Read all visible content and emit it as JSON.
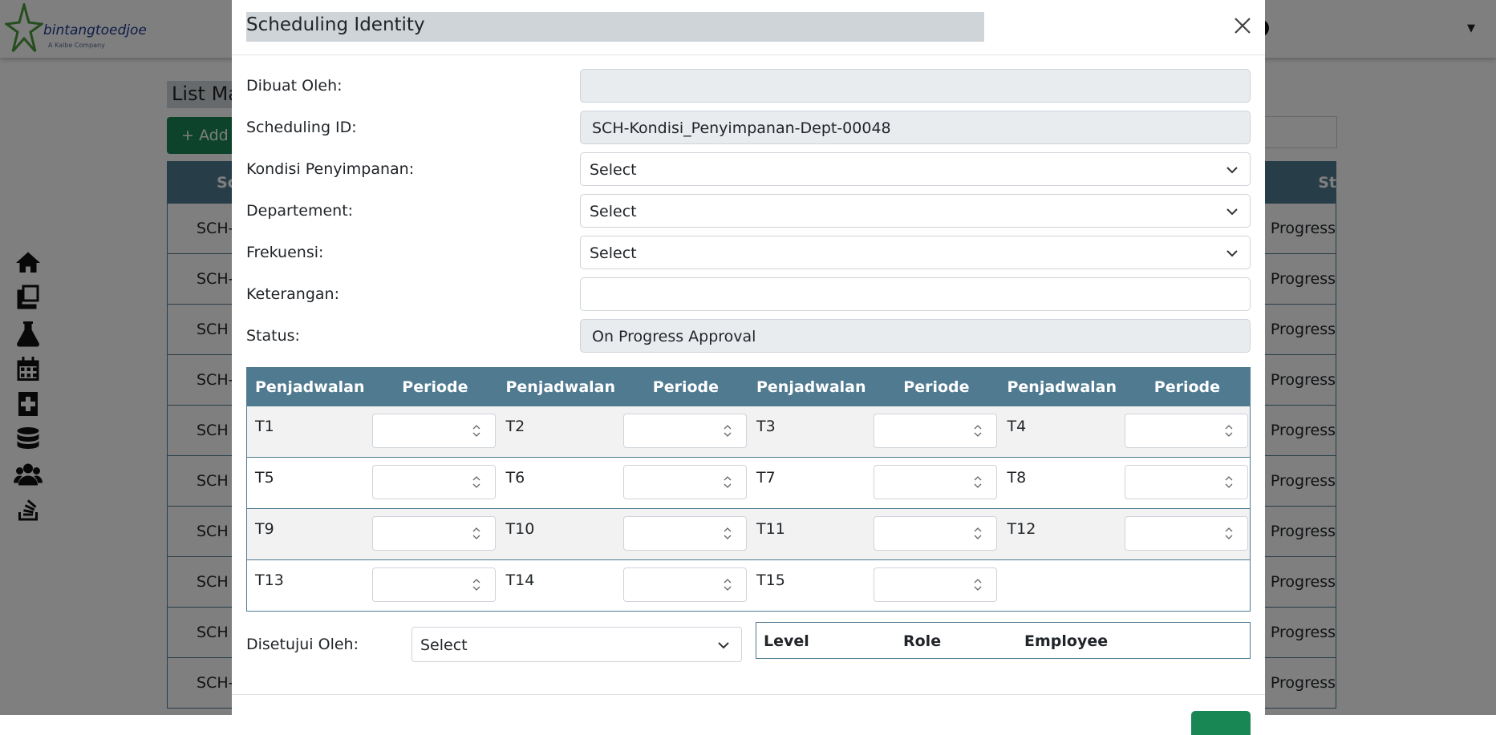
{
  "background": {
    "logo_text": "bintangtoedjoe",
    "logo_sub": "A Kalbe Company",
    "page_title": "List Ma",
    "add_button": "+ Add",
    "table_head_left": "Sc",
    "table_head_right": "St",
    "rows": [
      {
        "left": "SCH-",
        "right": "n Progress"
      },
      {
        "left": "SCH-",
        "right": "n Progress"
      },
      {
        "left": "SCH",
        "right": "n Progress"
      },
      {
        "left": "SCH-",
        "right": "n Progress"
      },
      {
        "left": "SCH",
        "right": "n Progress"
      },
      {
        "left": "SCH",
        "right": "n Progress"
      },
      {
        "left": "SCH",
        "right": "n Progress"
      },
      {
        "left": "SCH",
        "right": "n Progress"
      },
      {
        "left": "SCH",
        "right": "n Progress"
      },
      {
        "left": "SCH-",
        "right": "n Progress"
      }
    ],
    "sidebar_icons": [
      "home-icon",
      "copy-icon",
      "flask-icon",
      "calendar-icon",
      "medical-book-icon",
      "database-icon",
      "users-icon",
      "stack-icon"
    ]
  },
  "modal": {
    "title": "Scheduling Identity",
    "fields": {
      "dibuat_oleh": {
        "label": "Dibuat Oleh:",
        "value": ""
      },
      "scheduling_id": {
        "label": "Scheduling ID:",
        "value": "SCH-Kondisi_Penyimpanan-Dept-00048"
      },
      "kondisi": {
        "label": "Kondisi Penyimpanan:",
        "value": "Select"
      },
      "departement": {
        "label": "Departement:",
        "value": "Select"
      },
      "frekuensi": {
        "label": "Frekuensi:",
        "value": "Select"
      },
      "keterangan": {
        "label": "Keterangan:",
        "value": ""
      },
      "status": {
        "label": "Status:",
        "value": "On Progress Approval"
      }
    },
    "schedule": {
      "headers": [
        "Penjadwalan",
        "Periode",
        "Penjadwalan",
        "Periode",
        "Penjadwalan",
        "Periode",
        "Penjadwalan",
        "Periode"
      ],
      "rows": [
        [
          "T1",
          "T2",
          "T3",
          "T4"
        ],
        [
          "T5",
          "T6",
          "T7",
          "T8"
        ],
        [
          "T9",
          "T10",
          "T11",
          "T12"
        ],
        [
          "T13",
          "T14",
          "T15"
        ]
      ]
    },
    "approver": {
      "label": "Disetujui Oleh:",
      "value": "Select",
      "columns": [
        "Level",
        "Role",
        "Employee"
      ]
    }
  },
  "colors": {
    "primary": "#198754",
    "table_header": "#4f7a90",
    "title_bg": "#cfd4d9"
  }
}
